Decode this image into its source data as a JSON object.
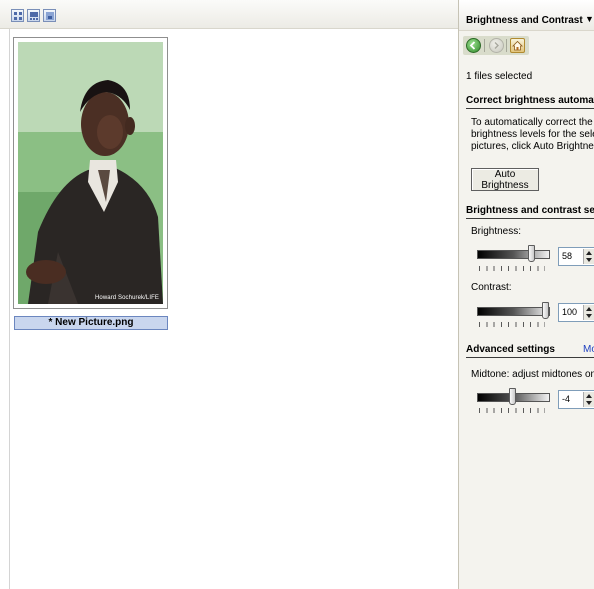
{
  "thumbnail": {
    "file_name": "* New Picture.png",
    "photo_credit": "Howard Sochurek/LIFE"
  },
  "view_toolbar": {
    "buttons": [
      "thumbnails-view-icon",
      "filmstrip-view-icon",
      "single-picture-view-icon"
    ]
  },
  "task_pane": {
    "title": "Brightness and Contrast",
    "dropdown_glyph": "▼",
    "nav": [
      "back-icon",
      "forward-icon",
      "home-icon"
    ],
    "files_selected": "1 files selected",
    "auto_section": {
      "title": "Correct brightness automatically",
      "description_lines": [
        "To automatically correct the",
        "brightness levels for the selected",
        "pictures, click Auto Brightness."
      ],
      "button_label": "Auto Brightness"
    },
    "settings_section": {
      "title": "Brightness and contrast settings",
      "brightness_label": "Brightness:",
      "brightness_value": "58",
      "contrast_label": "Contrast:",
      "contrast_value": "100"
    },
    "advanced_section": {
      "title": "Advanced settings",
      "more_link": "Mo",
      "midtone_label": "Midtone: adjust midtones only",
      "midtone_value": "-4"
    }
  },
  "colors": {
    "selection_fill": "#c9d6ee",
    "selection_border": "#6b86bf",
    "pane_background": "#f4f3ee",
    "link": "#1e3fbf"
  }
}
